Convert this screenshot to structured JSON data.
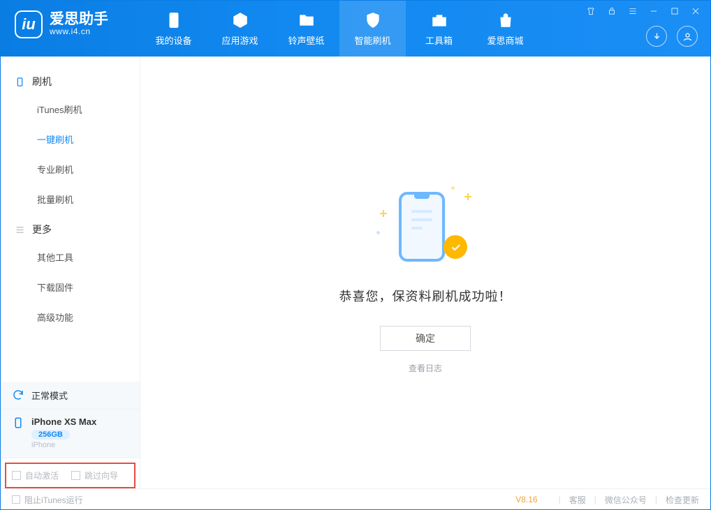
{
  "app": {
    "name_cn": "爱思助手",
    "name_en": "www.i4.cn"
  },
  "tabs": [
    {
      "label": "我的设备"
    },
    {
      "label": "应用游戏"
    },
    {
      "label": "铃声壁纸"
    },
    {
      "label": "智能刷机"
    },
    {
      "label": "工具箱"
    },
    {
      "label": "爱思商城"
    }
  ],
  "sidebar": {
    "group1_title": "刷机",
    "items1": [
      {
        "label": "iTunes刷机"
      },
      {
        "label": "一键刷机"
      },
      {
        "label": "专业刷机"
      },
      {
        "label": "批量刷机"
      }
    ],
    "group2_title": "更多",
    "items2": [
      {
        "label": "其他工具"
      },
      {
        "label": "下载固件"
      },
      {
        "label": "高级功能"
      }
    ]
  },
  "device": {
    "mode": "正常模式",
    "name": "iPhone XS Max",
    "storage": "256GB",
    "type": "iPhone"
  },
  "options": {
    "auto_activate": "自动激活",
    "skip_guide": "跳过向导"
  },
  "main": {
    "success_msg": "恭喜您，保资料刷机成功啦！",
    "ok": "确定",
    "view_log": "查看日志"
  },
  "footer": {
    "block_itunes": "阻止iTunes运行",
    "version": "V8.16",
    "support": "客服",
    "wechat": "微信公众号",
    "check_update": "检查更新"
  }
}
